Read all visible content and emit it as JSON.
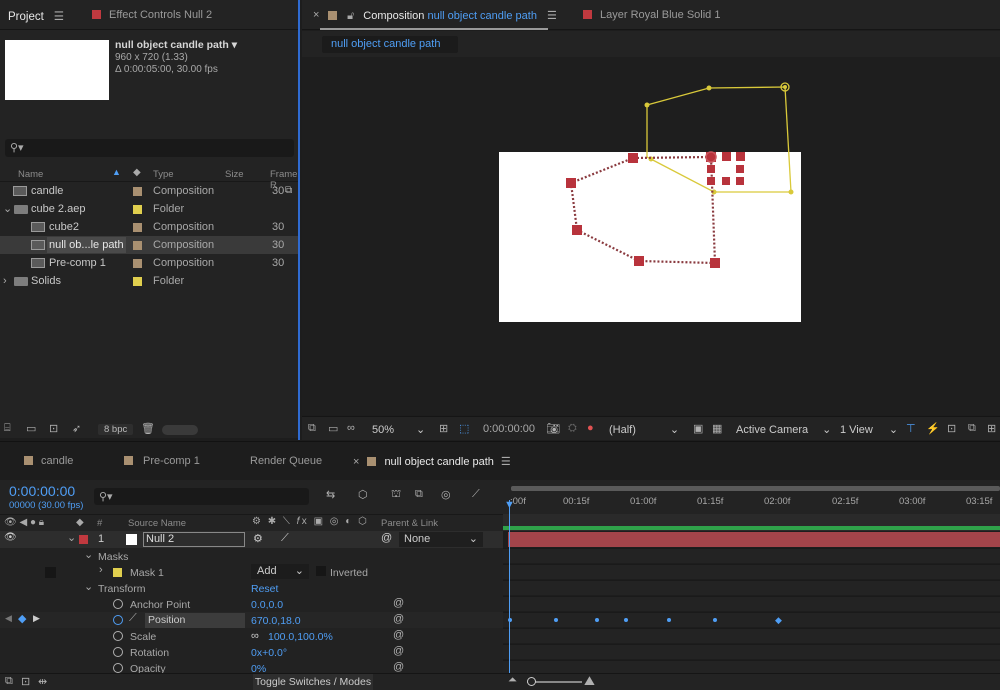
{
  "project_panel": {
    "tab_label": "Project",
    "effect_tab": "Effect Controls Null 2",
    "preview": {
      "name": "null object candle path",
      "resolution": "960 x 720 (1.33)",
      "duration": "Δ 0:00:05:00, 30.00 fps"
    },
    "search_placeholder": "",
    "columns": {
      "name": "Name",
      "type": "Type",
      "size": "Size",
      "frame": "Frame R"
    },
    "items": [
      {
        "name": "candle",
        "type": "Composition",
        "frame": "30",
        "color": "#a99071",
        "indent": 0
      },
      {
        "name": "cube 2.aep",
        "type": "Folder",
        "frame": "",
        "color": "#e0cf4e",
        "indent": 0
      },
      {
        "name": "cube2",
        "type": "Composition",
        "frame": "30",
        "color": "#a99071",
        "indent": 1
      },
      {
        "name": "null ob...le path",
        "type": "Composition",
        "frame": "30",
        "color": "#a99071",
        "indent": 1
      },
      {
        "name": "Pre-comp 1",
        "type": "Composition",
        "frame": "30",
        "color": "#a99071",
        "indent": 1
      },
      {
        "name": "Solids",
        "type": "Folder",
        "frame": "",
        "color": "#e0cf4e",
        "indent": 0
      }
    ],
    "bpc": "8 bpc"
  },
  "comp_panel": {
    "tab_prefix": "Composition",
    "tab_name": "null object candle path",
    "layer_tab": "Layer Royal Blue Solid 1",
    "breadcrumb": "null object candle path",
    "zoom": "50%",
    "timecode": "0:00:00:00",
    "resolution": "(Half)",
    "camera": "Active Camera",
    "view": "1 View"
  },
  "timeline": {
    "tabs": [
      "candle",
      "Pre-comp 1",
      "Render Queue",
      "null object candle path"
    ],
    "current_time": "0:00:00:00",
    "frame_info": "00000 (30.00 fps)",
    "ruler": [
      ":00f",
      "00:15f",
      "01:00f",
      "01:15f",
      "02:00f",
      "02:15f",
      "03:00f",
      "03:15f"
    ],
    "headers": {
      "num": "#",
      "source": "Source Name",
      "parent": "Parent & Link"
    },
    "layer": {
      "num": "1",
      "name": "Null 2",
      "parent": "None"
    },
    "masks_label": "Masks",
    "mask1": "Mask 1",
    "mask_mode": "Add",
    "inverted": "Inverted",
    "transform_label": "Transform",
    "reset": "Reset",
    "props": [
      {
        "name": "Anchor Point",
        "value": "0.0,0.0"
      },
      {
        "name": "Position",
        "value": "670.0,18.0"
      },
      {
        "name": "Scale",
        "value": "100.0,100.0%"
      },
      {
        "name": "Rotation",
        "value": "0x+0.0°"
      },
      {
        "name": "Opacity",
        "value": "0%"
      }
    ],
    "toggle_label": "Toggle Switches / Modes"
  }
}
